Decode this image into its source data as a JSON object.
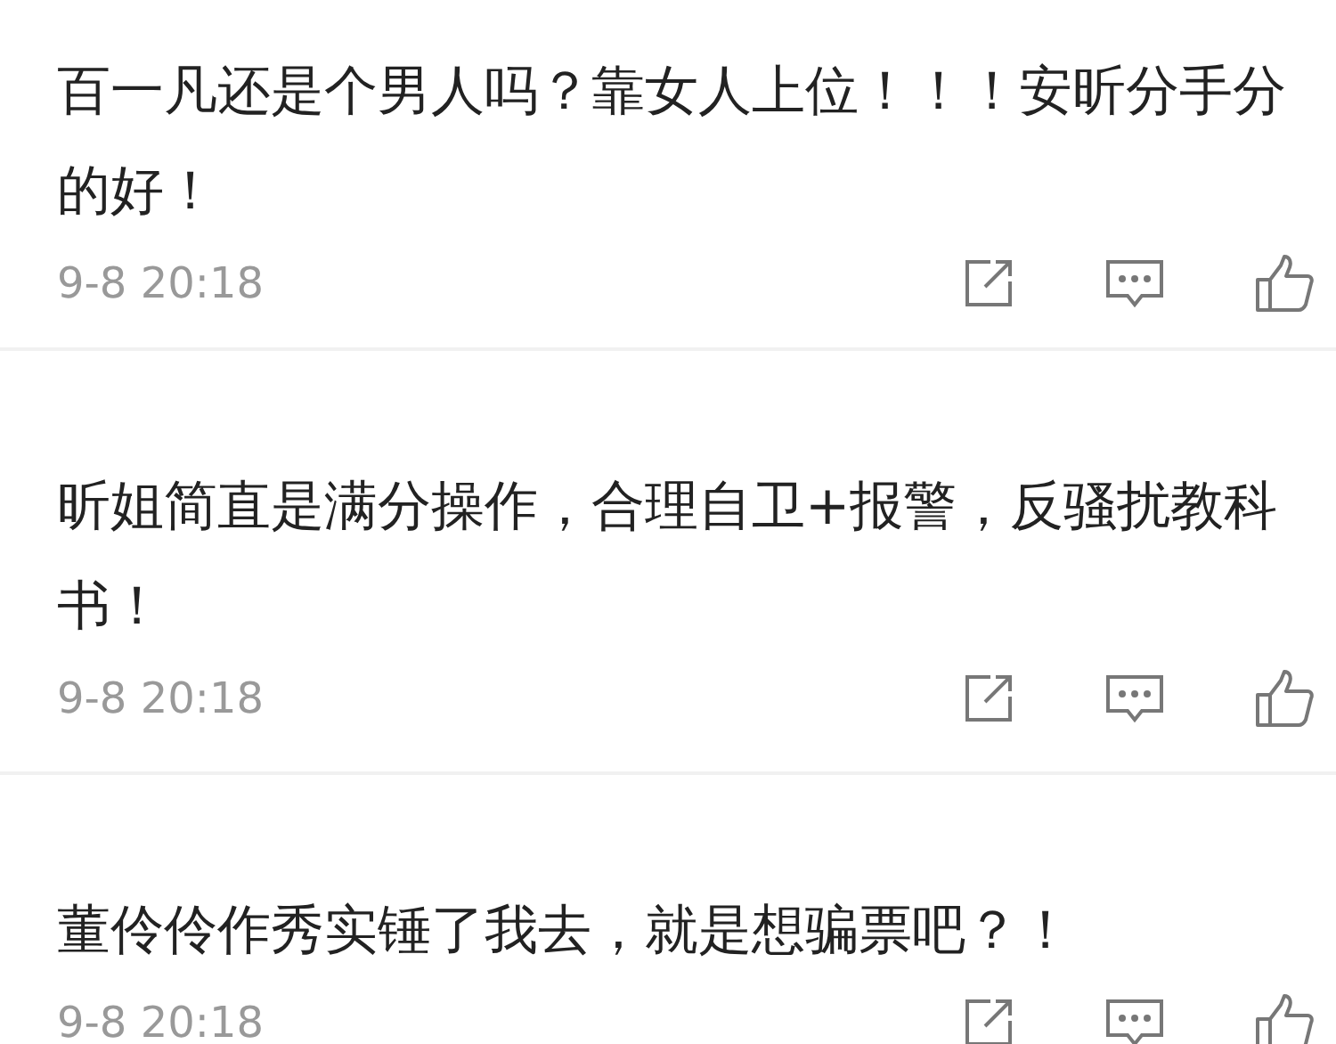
{
  "comments": [
    {
      "text": "百一凡还是个男人吗？靠女人上位！！！安昕分手分的好！",
      "time": "9-8 20:18"
    },
    {
      "text": "昕姐简直是满分操作，合理自卫+报警，反骚扰教科书！",
      "time": "9-8 20:18"
    },
    {
      "text": "董伶伶作秀实锤了我去，就是想骗票吧？！",
      "time": "9-8 20:18"
    }
  ]
}
